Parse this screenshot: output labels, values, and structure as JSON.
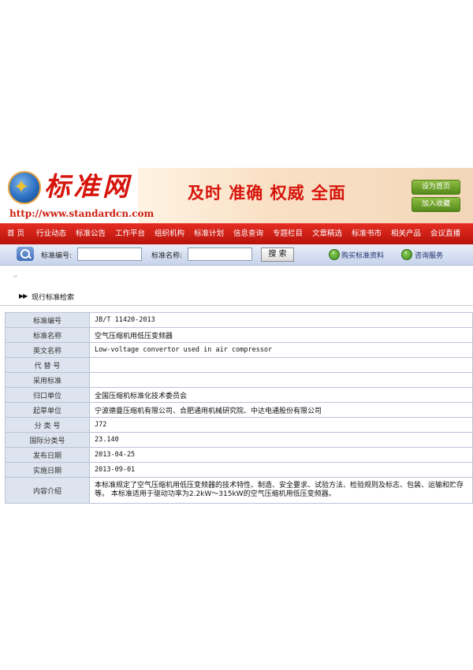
{
  "header": {
    "logo_text": "标准网",
    "logo_url": "http://www.standardcn.com",
    "slogan": "及时 准确 权威 全面",
    "set_home_label": "设为首页",
    "add_favorite_label": "加入收藏"
  },
  "nav": {
    "items": [
      "首 页",
      "行业动态",
      "标准公告",
      "工作平台",
      "组织机构",
      "标准计划",
      "信息查询",
      "专题栏目",
      "文章精选",
      "标准书市",
      "相关产品",
      "会议直播"
    ]
  },
  "search": {
    "number_label": "标准编号:",
    "number_value": "",
    "name_label": "标准名称:",
    "name_value": "",
    "button_label": "搜 索",
    "buy_link": "购买标准资料",
    "consult_link": "咨询服务"
  },
  "marker": "〃",
  "section_title": "现行标准检索",
  "details": {
    "rows": [
      {
        "label": "标准编号",
        "value": "JB/T 11420-2013"
      },
      {
        "label": "标准名称",
        "value": "空气压缩机用低压变频器"
      },
      {
        "label": "英文名称",
        "value": "Low-voltage convertor used in air compressor"
      },
      {
        "label": "代 替 号",
        "value": ""
      },
      {
        "label": "采用标准",
        "value": ""
      },
      {
        "label": "归口单位",
        "value": "全国压缩机标准化技术委员会"
      },
      {
        "label": "起草单位",
        "value": "宁波德曼压缩机有限公司、合肥通用机械研究院、中达电通股份有限公司"
      },
      {
        "label": "分 类 号",
        "value": "J72"
      },
      {
        "label": "国际分类号",
        "value": "23.140"
      },
      {
        "label": "发布日期",
        "value": "2013-04-25"
      },
      {
        "label": "实施日期",
        "value": "2013-09-01"
      },
      {
        "label": "内容介绍",
        "value": "本标准规定了空气压缩机用低压变频器的技术特性、制造、安全要求、试验方法、检验规则及标志、包装、运输和贮存等。 本标准适用于驱动功率为2.2kW～315kW的空气压缩机用低压变频器。"
      }
    ]
  }
}
